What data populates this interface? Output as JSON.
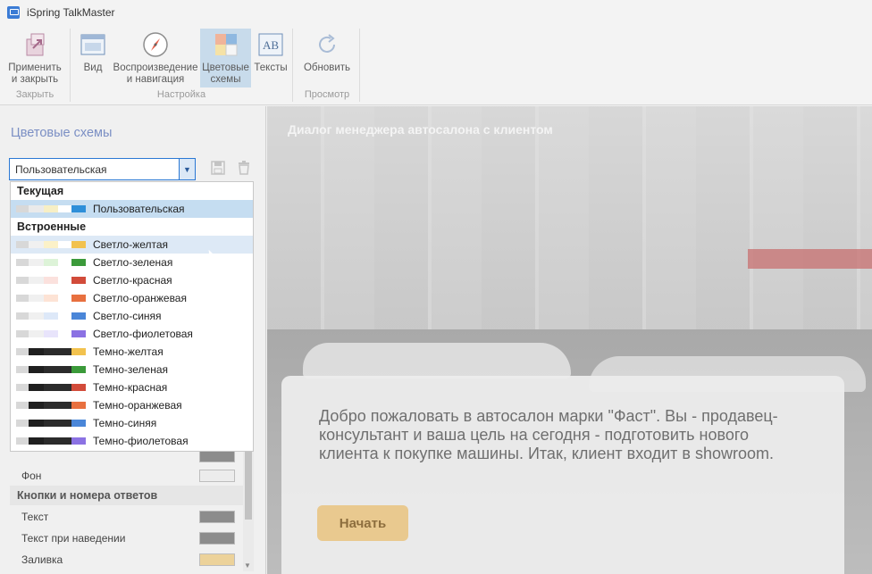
{
  "window": {
    "title": "iSpring TalkMaster"
  },
  "ribbon": {
    "apply_close": "Применить и закрыть",
    "view": "Вид",
    "playback_nav": "Воспроизведение и навигация",
    "color_schemes": "Цветовые схемы",
    "texts": "Тексты",
    "refresh": "Обновить",
    "group_close": "Закрыть",
    "group_settings": "Настройка",
    "group_preview": "Просмотр"
  },
  "sidebar": {
    "title": "Цветовые схемы",
    "combo_value": "Пользовательская",
    "dropdown": {
      "current_header": "Текущая",
      "current_item": {
        "label": "Пользовательская",
        "colors": [
          "#d8d8d8",
          "#eaeaea",
          "#f7efc5",
          "#ffffff",
          "#2e8fd9"
        ]
      },
      "builtin_header": "Встроенные",
      "items": [
        {
          "label": "Светло-желтая",
          "colors": [
            "#d8d8d8",
            "#f0f0f0",
            "#fbf1c8",
            "#ffffff",
            "#f2c24e"
          ]
        },
        {
          "label": "Светло-зеленая",
          "colors": [
            "#d8d8d8",
            "#f0f0f0",
            "#ddf3d8",
            "#ffffff",
            "#3b9a3a"
          ]
        },
        {
          "label": "Светло-красная",
          "colors": [
            "#d8d8d8",
            "#f0f0f0",
            "#fbe1dd",
            "#ffffff",
            "#d24b3a"
          ]
        },
        {
          "label": "Светло-оранжевая",
          "colors": [
            "#d8d8d8",
            "#f0f0f0",
            "#fde3d5",
            "#ffffff",
            "#e8703f"
          ]
        },
        {
          "label": "Светло-синяя",
          "colors": [
            "#d8d8d8",
            "#f0f0f0",
            "#dde8f8",
            "#ffffff",
            "#4a86d8"
          ]
        },
        {
          "label": "Светло-фиолетовая",
          "colors": [
            "#d8d8d8",
            "#f0f0f0",
            "#e8e4fb",
            "#ffffff",
            "#8b72e3"
          ]
        },
        {
          "label": "Темно-желтая",
          "colors": [
            "#d8d8d8",
            "#1f1f1f",
            "#2b2b2b",
            "#2b2b2b",
            "#f2c24e"
          ]
        },
        {
          "label": "Темно-зеленая",
          "colors": [
            "#d8d8d8",
            "#1f1f1f",
            "#2b2b2b",
            "#2b2b2b",
            "#3b9a3a"
          ]
        },
        {
          "label": "Темно-красная",
          "colors": [
            "#d8d8d8",
            "#1f1f1f",
            "#2b2b2b",
            "#2b2b2b",
            "#d24b3a"
          ]
        },
        {
          "label": "Темно-оранжевая",
          "colors": [
            "#d8d8d8",
            "#1f1f1f",
            "#2b2b2b",
            "#2b2b2b",
            "#e8703f"
          ]
        },
        {
          "label": "Темно-синяя",
          "colors": [
            "#d8d8d8",
            "#1f1f1f",
            "#2b2b2b",
            "#2b2b2b",
            "#4a86d8"
          ]
        },
        {
          "label": "Темно-фиолетовая",
          "colors": [
            "#d8d8d8",
            "#1f1f1f",
            "#2b2b2b",
            "#2b2b2b",
            "#8b72e3"
          ]
        }
      ]
    },
    "props": {
      "background": {
        "label": "Фон",
        "color": "#ececec"
      },
      "buttons_header": "Кнопки и номера ответов",
      "text": {
        "label": "Текст",
        "color": "#8c8c8c"
      },
      "text_hover": {
        "label": "Текст при наведении",
        "color": "#8c8c8c"
      },
      "fill": {
        "label": "Заливка",
        "color": "#ecd29a"
      },
      "hidden_top": {
        "color": "#8c8c8c"
      }
    }
  },
  "preview": {
    "scene_title": "Диалог менеджера автосалона с клиентом",
    "dialog_text": "Добро пожаловать в автосалон марки \"Фаст\". Вы - продавец-консультант и ваша цель на сегодня - подготовить нового клиента к покупке машины. Итак, клиент входит в showroom.",
    "start_button": "Начать"
  }
}
